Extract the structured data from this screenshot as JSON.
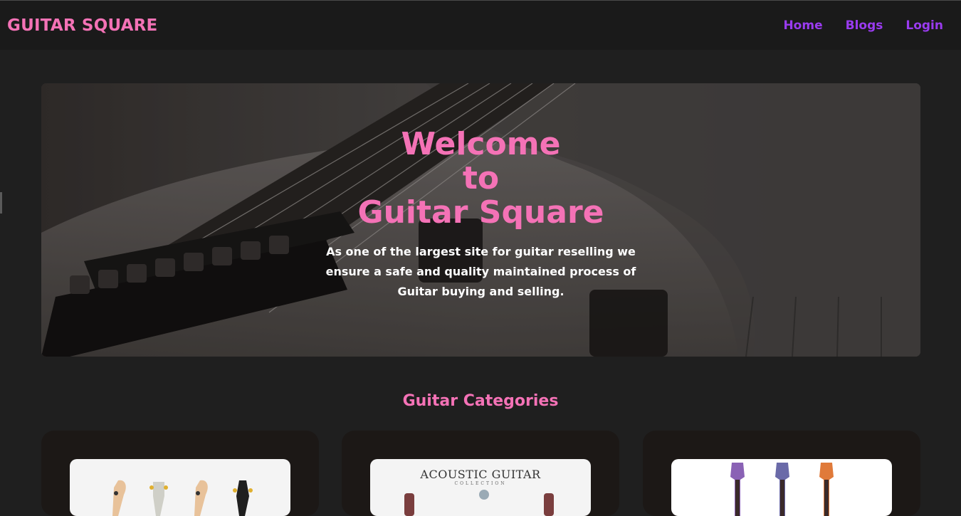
{
  "nav": {
    "brand": "GUITAR SQUARE",
    "links": [
      "Home",
      "Blogs",
      "Login"
    ]
  },
  "hero": {
    "title_lines": [
      "Welcome",
      "to",
      "Guitar Square"
    ],
    "description": "As one of the largest site for guitar reselling we ensure a safe and quality maintained process of Guitar buying and selling."
  },
  "categories": {
    "title": "Guitar Categories",
    "cards": [
      {
        "image": "electric-guitar-headstocks-image"
      },
      {
        "image": "acoustic-guitar-image",
        "caption": "ACOUSTIC GUITAR",
        "subcaption": "COLLECTION"
      },
      {
        "image": "ukulele-headstocks-image"
      }
    ]
  },
  "colors": {
    "accent_pink": "#f472b6",
    "nav_purple": "#9a3bf0",
    "background": "#1f1f1f",
    "navbar_bg": "#1a1a1a"
  }
}
